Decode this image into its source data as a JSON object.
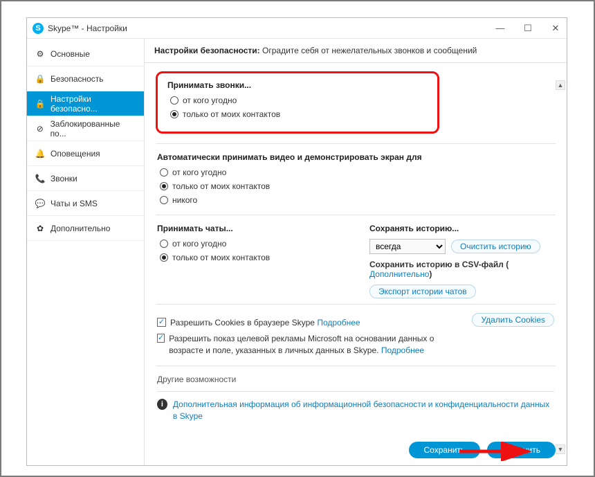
{
  "window": {
    "title": "Skype™ - Настройки"
  },
  "winbtns": {
    "min": "—",
    "max": "☐",
    "close": "✕"
  },
  "sidebar": {
    "items": [
      {
        "label": "Основные",
        "icon": "⚙"
      },
      {
        "label": "Безопасность",
        "icon": "🔒"
      },
      {
        "label": "Настройки безопасно...",
        "icon": "🔒",
        "active": true
      },
      {
        "label": "Заблокированные по...",
        "icon": "⊘"
      },
      {
        "label": "Оповещения",
        "icon": "🔔"
      },
      {
        "label": "Звонки",
        "icon": "📞"
      },
      {
        "label": "Чаты и SMS",
        "icon": "💬"
      },
      {
        "label": "Дополнительно",
        "icon": "✿"
      }
    ]
  },
  "header": {
    "bold": "Настройки безопасности:",
    "rest": "Оградите себя от нежелательных звонков и сообщений"
  },
  "calls": {
    "title": "Принимать звонки...",
    "opt_any": "от кого угодно",
    "opt_contacts": "только от моих контактов",
    "selected": "contacts"
  },
  "video": {
    "title": "Автоматически принимать видео и демонстрировать экран для",
    "opt_any": "от кого угодно",
    "opt_contacts": "только от моих контактов",
    "opt_none": "никого",
    "selected": "contacts"
  },
  "chats": {
    "title": "Принимать чаты...",
    "opt_any": "от кого угодно",
    "opt_contacts": "только от моих контактов",
    "selected": "contacts"
  },
  "history": {
    "title": "Сохранять историю...",
    "select_value": "всегда",
    "clear_btn": "Очистить историю",
    "csv_label": "Сохранить историю в CSV-файл (",
    "csv_link": "Дополнительно",
    "csv_close": ")",
    "export_btn": "Экспорт истории чатов"
  },
  "cookies": {
    "allow_label": "Разрешить Cookies в браузере Skype",
    "more": "Подробнее",
    "delete_btn": "Удалить Cookies"
  },
  "ads": {
    "label": "Разрешить показ целевой рекламы Microsoft на основании данных о возрасте и поле, указанных в личных данных в Skype.",
    "more": "Подробнее"
  },
  "other": {
    "title": "Другие возможности",
    "info": "Дополнительная информация об информационной безопасности и конфиденциальности данных в Skype"
  },
  "buttons": {
    "save": "Сохранить",
    "cancel": "Отменить"
  }
}
